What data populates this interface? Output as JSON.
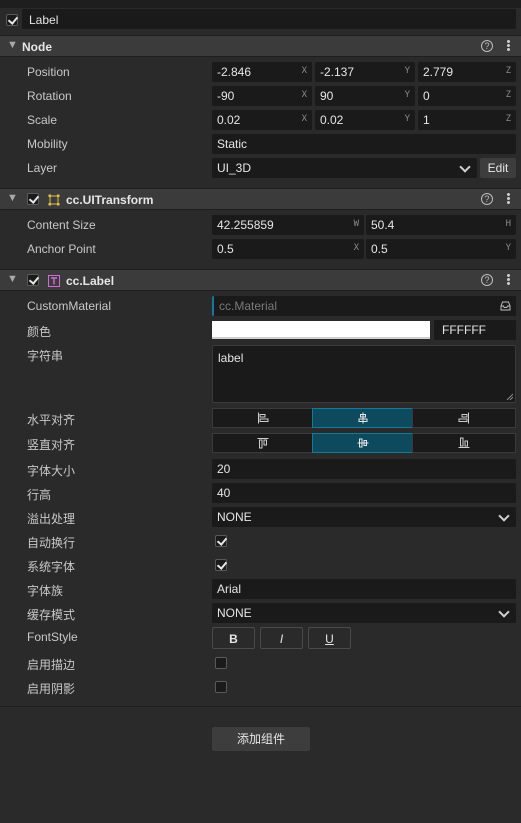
{
  "node_name": "Label",
  "node_section": {
    "title": "Node",
    "position": {
      "label": "Position",
      "x": "-2.846",
      "y": "-2.137",
      "z": "2.779"
    },
    "rotation": {
      "label": "Rotation",
      "x": "-90",
      "y": "90",
      "z": "0"
    },
    "scale": {
      "label": "Scale",
      "x": "0.02",
      "y": "0.02",
      "z": "1"
    },
    "mobility": {
      "label": "Mobility",
      "value": "Static"
    },
    "layer": {
      "label": "Layer",
      "value": "UI_3D",
      "edit_label": "Edit"
    },
    "axes": {
      "x": "X",
      "y": "Y",
      "z": "Z",
      "w": "W",
      "h": "H"
    }
  },
  "uitransform": {
    "title": "cc.UITransform",
    "content_size": {
      "label": "Content Size",
      "w": "42.255859",
      "h": "50.4"
    },
    "anchor_point": {
      "label": "Anchor Point",
      "x": "0.5",
      "y": "0.5"
    }
  },
  "label_comp": {
    "title": "cc.Label",
    "custom_material": {
      "label": "CustomMaterial",
      "placeholder": "cc.Material"
    },
    "color": {
      "label": "颜色",
      "hex": "FFFFFF",
      "swatch": "#ffffff"
    },
    "string": {
      "label": "字符串",
      "value": "label"
    },
    "h_align": {
      "label": "水平对齐",
      "active_index": 1
    },
    "v_align": {
      "label": "竖直对齐",
      "active_index": 1
    },
    "font_size": {
      "label": "字体大小",
      "value": "20"
    },
    "line_height": {
      "label": "行高",
      "value": "40"
    },
    "overflow": {
      "label": "溢出处理",
      "value": "NONE"
    },
    "wrap": {
      "label": "自动换行",
      "checked": true
    },
    "system_font": {
      "label": "系统字体",
      "checked": true
    },
    "font_family": {
      "label": "字体族",
      "value": "Arial"
    },
    "cache_mode": {
      "label": "缓存模式",
      "value": "NONE"
    },
    "font_style": {
      "label": "FontStyle",
      "bold": "B",
      "italic": "I",
      "underline": "U"
    },
    "outline": {
      "label": "启用描边",
      "checked": false
    },
    "shadow": {
      "label": "启用阴影",
      "checked": false
    }
  },
  "add_component_label": "添加组件",
  "colors": {
    "accent": "#137a99",
    "active_segment": "#0e4a5e",
    "panel": "#2a2a2a",
    "field": "#1a1a1a"
  }
}
